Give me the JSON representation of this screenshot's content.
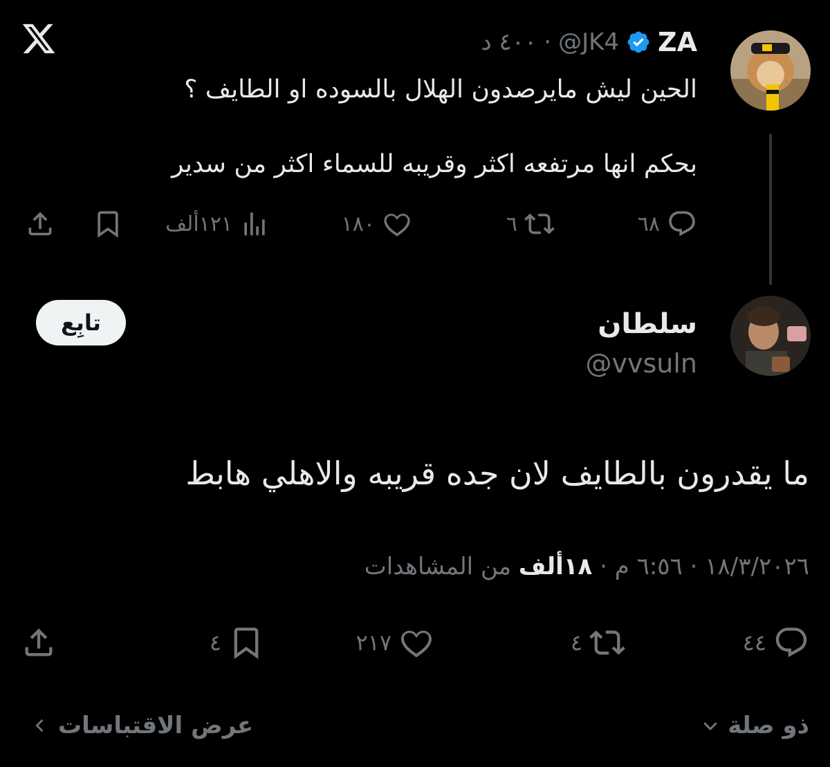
{
  "header": {
    "logo_icon": "x-logo-icon"
  },
  "parent_tweet": {
    "name": "ZA",
    "verified": true,
    "handle": "@JK4",
    "time": "٤٠٠ د",
    "separator": "·",
    "text_line1": "الحين ليش مايرصدون الهلال بالسوده او الطايف ؟",
    "text_line2": "بحكم انها مرتفعه اكثر وقريبه للسماء اكثر من سدير",
    "actions": {
      "replies": "٦٨",
      "retweets": "٦",
      "likes": "١٨٠",
      "views": "١٢١ألف"
    }
  },
  "reply_tweet": {
    "name": "سلطان",
    "handle": "@vvsuln",
    "follow_label": "تابِع",
    "text": "ما يقدرون بالطايف لان جده قريبه والاهلي هابط",
    "timestamp_prefix": "١٨/٣/٢٠٢٦ · ٦:٥٦ م · ",
    "views_count": "١٨ألف",
    "views_suffix": " من المشاهدات",
    "actions": {
      "replies": "٤٤",
      "retweets": "٤",
      "likes": "٢١٧",
      "bookmarks": "٤"
    }
  },
  "footer": {
    "related_label": "ذو صلة",
    "quotes_label": "عرض الاقتباسات"
  },
  "colors": {
    "background": "#000000",
    "text": "#e7e9ea",
    "muted": "#71767b",
    "verified": "#1d9bf0"
  }
}
